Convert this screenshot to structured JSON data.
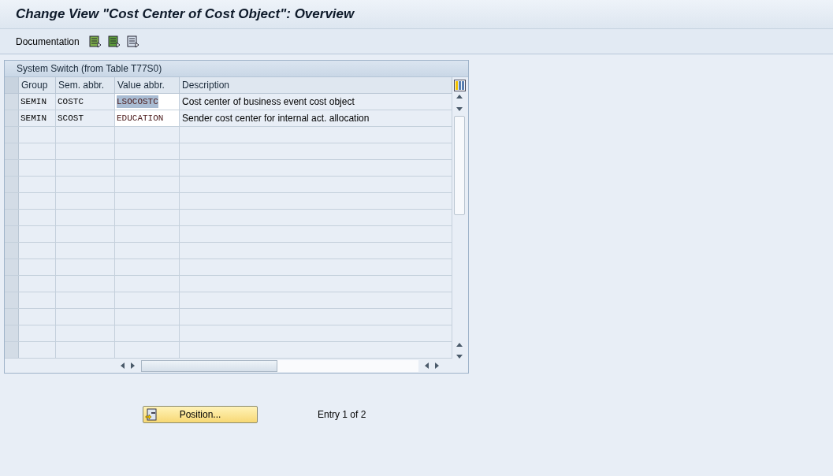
{
  "window": {
    "title": "Change View \"Cost Center of Cost Object\": Overview"
  },
  "toolbar": {
    "label": "Documentation"
  },
  "table": {
    "title": "System Switch (from Table T77S0)",
    "columns": [
      "Group",
      "Sem. abbr.",
      "Value abbr.",
      "Description"
    ],
    "rows": [
      {
        "group": "SEMIN",
        "sem_abbr": "COSTC",
        "value_abbr": "LSOCOSTC",
        "description": "Cost center of business event cost object",
        "selected": true
      },
      {
        "group": "SEMIN",
        "sem_abbr": "SCOST",
        "value_abbr": "EDUCATION",
        "description": "Sender cost center for internal act. allocation",
        "selected": false
      }
    ]
  },
  "position_button": {
    "label": "Position..."
  },
  "entry_info": "Entry 1 of 2"
}
